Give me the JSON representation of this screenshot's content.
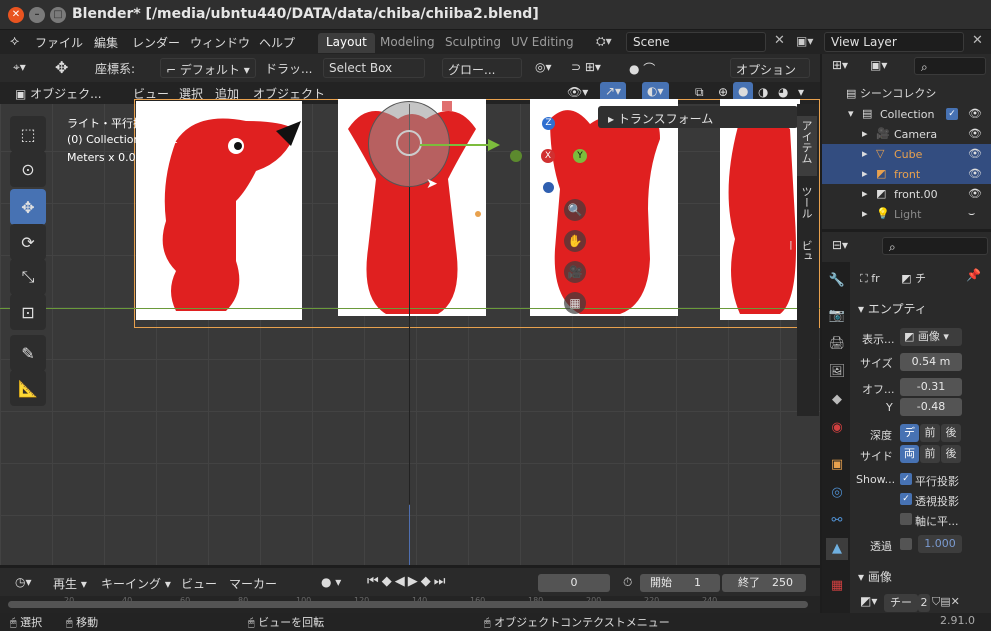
{
  "window": {
    "title": "Blender* [/media/ubntu440/DATA/data/chiba/chiiba2.blend]"
  },
  "menu": [
    "ファイル",
    "編集",
    "レンダー",
    "ウィンドウ",
    "ヘルプ"
  ],
  "workspaces": [
    "Layout",
    "Modeling",
    "Sculpting",
    "UV Editing"
  ],
  "scene": {
    "label": "Scene"
  },
  "view_layer": {
    "label": "View Layer"
  },
  "vp_header": {
    "coord_label": "座標系:",
    "coord_value": "デフォルト",
    "drag_label": "ドラッ...",
    "select_box": "Select Box",
    "global": "グロー...",
    "options": "オプション"
  },
  "vp_header2": {
    "mode": "オブジェク...",
    "view": "ビュー",
    "select": "選択",
    "add": "追加",
    "object": "オブジェクト"
  },
  "overlay": {
    "line1": "ライト・平行投影",
    "line2": "(0) Collection | front",
    "line3": "Meters x 0.01"
  },
  "npanel": {
    "transform": "トランスフォーム",
    "tab_item": "アイテム",
    "tab_tool": "ツール",
    "tab_view": "ビュー"
  },
  "outliner": {
    "title": "シーンコレクシ",
    "rows": [
      {
        "label": "Collection",
        "highlight": false,
        "color": "#dcdcdc"
      },
      {
        "label": "Camera",
        "highlight": false,
        "color": "#dcdcdc"
      },
      {
        "label": "Cube",
        "highlight": true,
        "color": "#e8a14e"
      },
      {
        "label": "front",
        "highlight": true,
        "color": "#e8a14e"
      },
      {
        "label": "front.00",
        "highlight": false,
        "color": "#dcdcdc"
      },
      {
        "label": "Light",
        "highlight": false,
        "color": "#8a8a8a"
      }
    ]
  },
  "props": {
    "breadcrumb_a": "fr",
    "breadcrumb_b": "チ",
    "section": "エンプティ",
    "display_label": "表示...",
    "display_value": "画像",
    "size_label": "サイズ",
    "size_value": "0.54 m",
    "offset_label": "オフ...",
    "offset_x": "-0.31",
    "y_label": "Y",
    "offset_y": "-0.48",
    "depth_label": "深度",
    "depth_options": [
      "デ",
      "前",
      "後"
    ],
    "side_label": "サイド",
    "side_options": [
      "両",
      "前",
      "後"
    ],
    "show_label": "Show...",
    "opt_ortho": "平行投影",
    "opt_persp": "透視投影",
    "opt_axis": "軸に平...",
    "alpha_label": "透過",
    "alpha_value": "1.000",
    "image_section": "画像",
    "image_name": "チー",
    "image_users": "2"
  },
  "timeline": {
    "playback": "再生",
    "keying": "キーイング",
    "view": "ビュー",
    "marker": "マーカー",
    "current_frame": "0",
    "start_label": "開始",
    "start_value": "1",
    "end_label": "終了",
    "end_value": "250",
    "ticks": [
      "20",
      "40",
      "60",
      "80",
      "100",
      "120",
      "140",
      "160",
      "180",
      "200",
      "220",
      "240"
    ]
  },
  "status": {
    "select": "選択",
    "move": "移動",
    "rotate_view": "ビューを回転",
    "context_menu": "オブジェクトコンテクストメニュー",
    "version": "2.91.0"
  }
}
